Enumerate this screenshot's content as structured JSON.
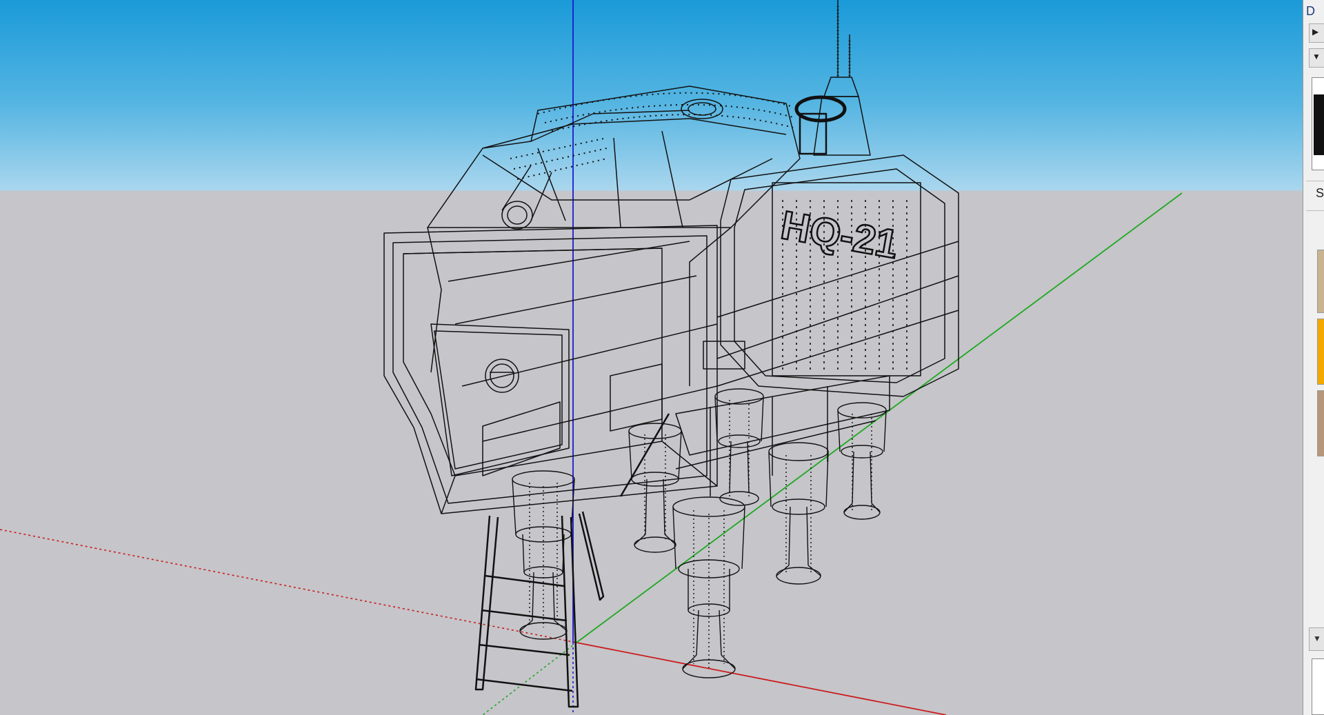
{
  "right_panel": {
    "title_fragment": "D",
    "label_fragment": "S",
    "play_button_icon": "play-triangle-icon",
    "dropdown_button_icon": "chevron-down-icon",
    "scroll_button_icon": "chevron-down-icon"
  },
  "model": {
    "decal_text": "HQ-21"
  },
  "colors": {
    "sky_top": "#1a9ad8",
    "sky_horizon": "#a9d6ee",
    "ground": "#c5c5ca",
    "axis_red": "#cc1a1a",
    "axis_green": "#1ea81e",
    "axis_blue": "#1a1acc",
    "wireframe": "#111111",
    "swatch_tan": "#c9b48f",
    "swatch_gold": "#f2a900",
    "swatch_brown": "#b69779"
  }
}
